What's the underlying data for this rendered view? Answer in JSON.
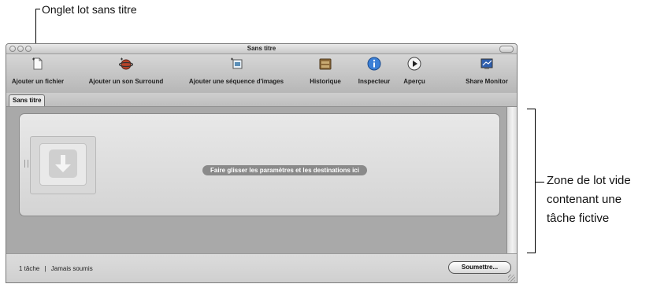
{
  "callouts": {
    "tab_label": "Onglet lot sans titre",
    "empty_batch_lines": [
      "Zone de lot vide",
      "contenant une",
      "tâche fictive"
    ]
  },
  "window": {
    "title": "Sans titre"
  },
  "toolbar": {
    "items": [
      {
        "label": "Ajouter un fichier",
        "icon": "add-file-icon"
      },
      {
        "label": "Ajouter un son Surround",
        "icon": "surround-icon"
      },
      {
        "label": "Ajouter une séquence d'images",
        "icon": "image-sequence-icon"
      },
      {
        "label": "Historique",
        "icon": "history-icon"
      },
      {
        "label": "Inspecteur",
        "icon": "inspector-icon"
      },
      {
        "label": "Aperçu",
        "icon": "preview-icon"
      },
      {
        "label": "Share Monitor",
        "icon": "share-monitor-icon"
      }
    ]
  },
  "tabs": [
    {
      "label": "Sans titre"
    }
  ],
  "batch": {
    "placeholder": "Faire glisser les paramètres et les destinations ici"
  },
  "status": {
    "count": "1 tâche",
    "separator": "|",
    "submitted": "Jamais soumis"
  },
  "submit_label": "Soumettre..."
}
